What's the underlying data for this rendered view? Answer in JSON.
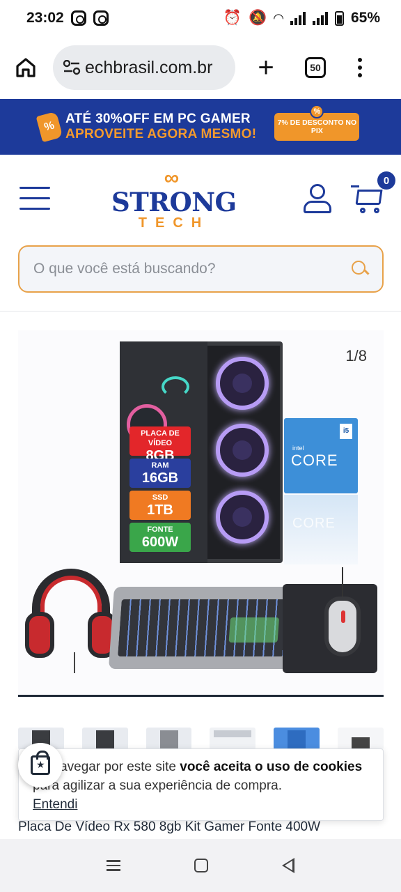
{
  "status_bar": {
    "time": "23:02",
    "battery": "65%"
  },
  "browser": {
    "url": "techbrasil.com.br",
    "url_visible": "echbrasil.com.br",
    "tab_count": "50",
    "new_tab_glyph": "+"
  },
  "promo": {
    "line1": "ATÉ 30%OFF EM PC GAMER",
    "line2": "APROVEITE AGORA MESMO!",
    "pix_badge": "7% DE DESCONTO NO PIX",
    "tag_glyph": "%",
    "colors": {
      "background": "#1d3a9a",
      "accent": "#f0962a"
    }
  },
  "header": {
    "logo_top": "STRONG",
    "logo_bottom": "TECH",
    "logo_symbol": "∞",
    "cart_count": "0",
    "icons": [
      "menu-icon",
      "user-icon",
      "cart-icon"
    ]
  },
  "search": {
    "placeholder": "O que você está buscando?",
    "value": ""
  },
  "gallery": {
    "counter": "1/8",
    "specs": [
      {
        "label": "PLACA DE VÍDEO",
        "value": "8GB",
        "color": "#e3262a"
      },
      {
        "label": "RAM",
        "value": "16GB",
        "color": "#2a3f9e"
      },
      {
        "label": "SSD",
        "value": "1TB",
        "color": "#f07a22"
      },
      {
        "label": "FONTE",
        "value": "600W",
        "color": "#3aa64a"
      }
    ],
    "cpu_box": {
      "brand": "intel",
      "name": "CORE",
      "tier": "i5"
    }
  },
  "cookie": {
    "text_start": "Ao navegar por este site ",
    "text_bold": "você aceita o uso de cookies",
    "text_end": " para agilizar a sua experiência de compra.",
    "button": "Entendi"
  },
  "product": {
    "title": "Placa De Vídeo Rx 580 8gb Kit Gamer Fonte 400W"
  }
}
